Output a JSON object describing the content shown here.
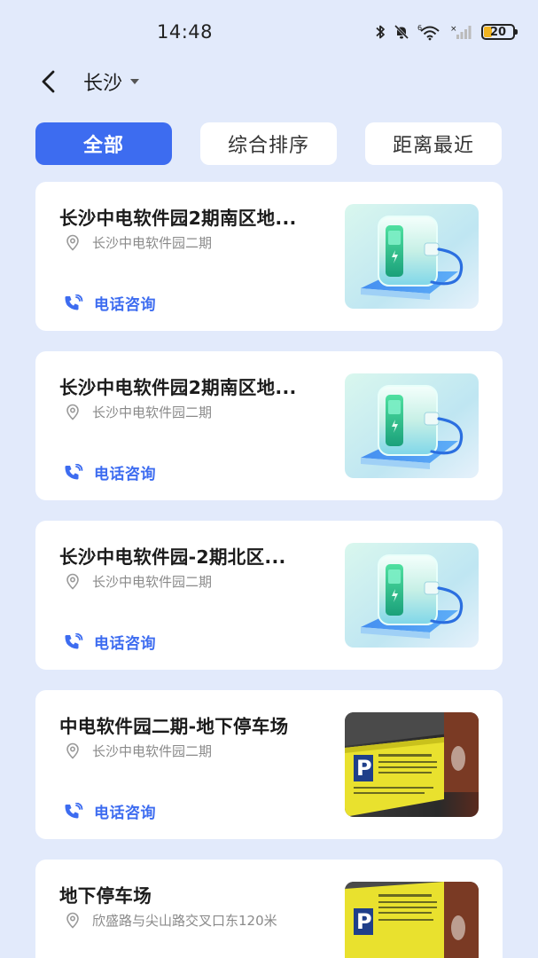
{
  "status_bar": {
    "time": "14:48",
    "battery_level": "20",
    "icons": [
      "bluetooth-icon",
      "mute-bell-icon",
      "wifi-6-icon",
      "cellular-signal-icon",
      "battery-icon"
    ]
  },
  "header": {
    "back_icon": "chevron-left-icon",
    "city": "长沙",
    "city_dropdown_icon": "caret-down-icon"
  },
  "tabs": [
    {
      "label": "全部",
      "active": true
    },
    {
      "label": "综合排序",
      "active": false
    },
    {
      "label": "距离最近",
      "active": false
    }
  ],
  "colors": {
    "accent": "#3d6cf0",
    "background": "#e2eafb",
    "card": "#ffffff",
    "muted_text": "#8a8a8a"
  },
  "stations": [
    {
      "title": "长沙中电软件园2期南区地...",
      "address": "长沙中电软件园二期",
      "phone_label": "电话咨询",
      "image": "ev-charger-illustration"
    },
    {
      "title": "长沙中电软件园2期南区地...",
      "address": "长沙中电软件园二期",
      "phone_label": "电话咨询",
      "image": "ev-charger-illustration"
    },
    {
      "title": "长沙中电软件园-2期北区...",
      "address": "长沙中电软件园二期",
      "phone_label": "电话咨询",
      "image": "ev-charger-illustration"
    },
    {
      "title": "中电软件园二期-地下停车场",
      "address": "长沙中电软件园二期",
      "phone_label": "电话咨询",
      "image": "parking-sign-photo"
    },
    {
      "title": "地下停车场",
      "address": "欣盛路与尖山路交叉口东120米",
      "phone_label": "",
      "image": "parking-sign-photo"
    }
  ]
}
